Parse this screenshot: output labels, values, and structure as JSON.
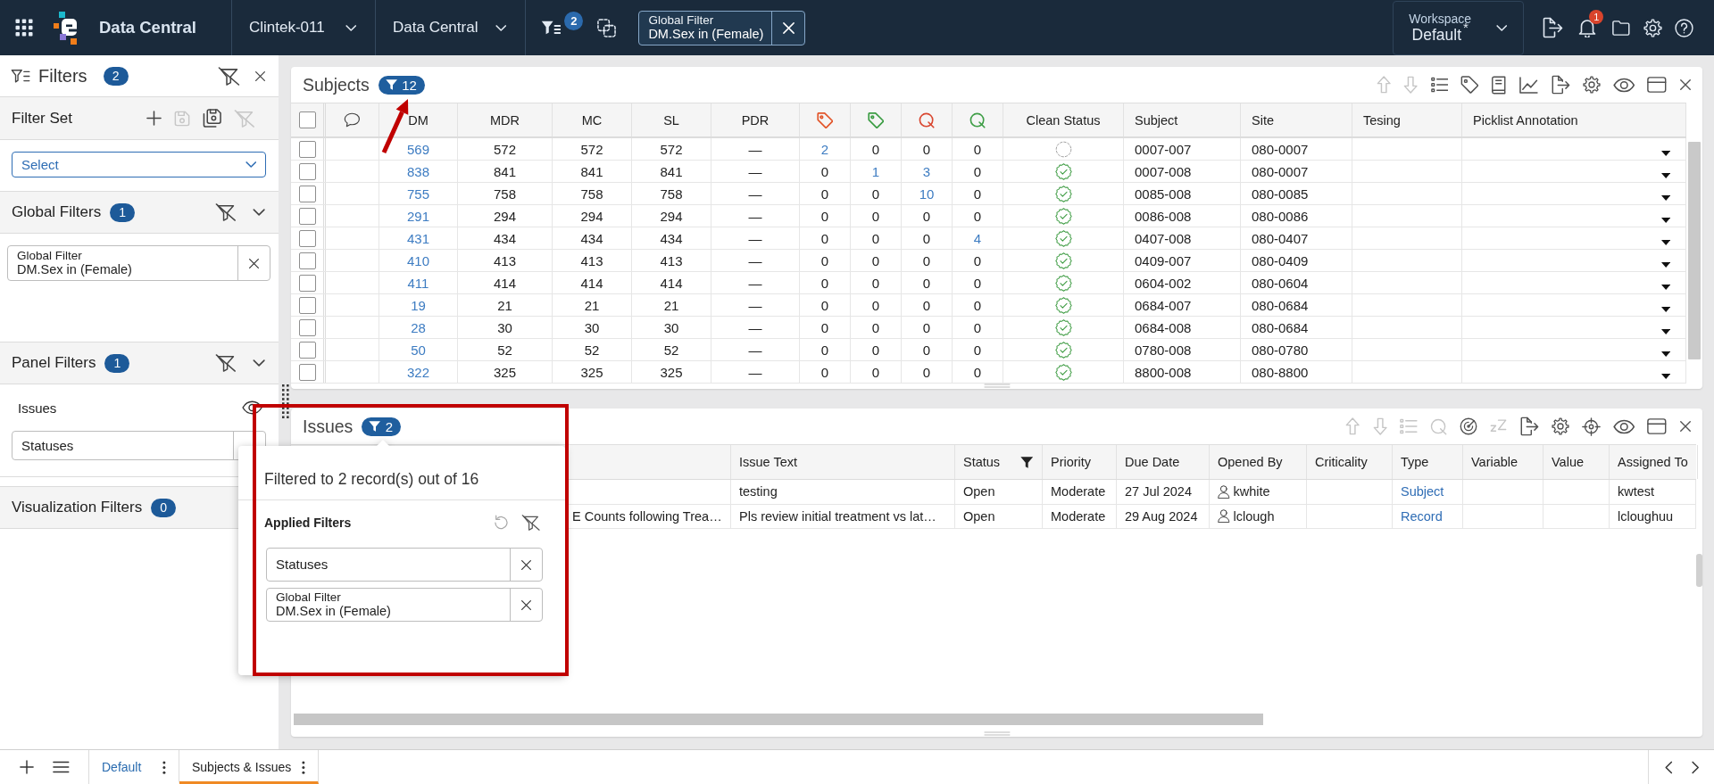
{
  "top_bar": {
    "app_title": "Data Central",
    "study": "Clintek-011",
    "module": "Data Central",
    "filter_count": "2",
    "global_filter": {
      "title": "Global Filter",
      "value": "DM.Sex in (Female)"
    },
    "workspace": {
      "label": "Workspace",
      "modified_mark": "*",
      "name": "Default"
    },
    "notification_count": "1"
  },
  "filters_panel": {
    "title": "Filters",
    "count": "2",
    "filter_set": {
      "title": "Filter Set",
      "actions": [
        {
          "kind": "add",
          "disabled": false
        },
        {
          "kind": "save",
          "disabled": true
        },
        {
          "kind": "save-copy",
          "disabled": false
        },
        {
          "kind": "clear",
          "disabled": true
        }
      ],
      "select": {
        "placeholder": "Select"
      }
    },
    "sections": [
      {
        "kind": "global",
        "title": "Global Filters",
        "count": "1",
        "expanded": true,
        "chips": [
          {
            "title": "Global Filter",
            "value": "DM.Sex in (Female)"
          }
        ]
      },
      {
        "kind": "panel",
        "title": "Panel Filters",
        "count": "1",
        "expanded": true,
        "groups": [
          {
            "name": "Issues",
            "field": {
              "placeholder": "Statuses"
            }
          }
        ]
      },
      {
        "kind": "visualization",
        "title": "Visualization Filters",
        "count": "0"
      }
    ]
  },
  "subjects_panel": {
    "title": "Subjects",
    "filter_count": "12",
    "toolbar": [
      {
        "kind": "move-up",
        "disabled": true
      },
      {
        "kind": "move-down",
        "disabled": true
      },
      {
        "kind": "list",
        "disabled": false
      },
      {
        "kind": "tag",
        "disabled": false
      },
      {
        "kind": "book",
        "disabled": false
      },
      {
        "kind": "chart",
        "disabled": false
      },
      {
        "kind": "export",
        "disabled": false
      },
      {
        "kind": "settings",
        "disabled": false
      },
      {
        "kind": "view",
        "disabled": false
      },
      {
        "kind": "layout",
        "disabled": false
      },
      {
        "kind": "close",
        "disabled": false
      }
    ],
    "table": {
      "select_all_checked": false,
      "columns": [
        {
          "kind": "comments"
        },
        {
          "kind": "number",
          "label": "DM"
        },
        {
          "kind": "number",
          "label": "MDR"
        },
        {
          "kind": "number",
          "label": "MC"
        },
        {
          "kind": "number",
          "label": "SL"
        },
        {
          "kind": "number",
          "label": "PDR"
        },
        {
          "kind": "tag",
          "color": "#e2572c"
        },
        {
          "kind": "tag",
          "color": "#3d9d45"
        },
        {
          "kind": "query",
          "color": "#d9462f"
        },
        {
          "kind": "query",
          "color": "#3d9d45"
        },
        {
          "kind": "status",
          "label": "Clean Status"
        },
        {
          "kind": "text",
          "label": "Subject"
        },
        {
          "kind": "text",
          "label": "Site"
        },
        {
          "kind": "text",
          "label": "Tesing"
        },
        {
          "kind": "text",
          "label": "Picklist Annotation"
        }
      ],
      "rows": [
        {
          "checked": false,
          "dm": "569",
          "mdr": "572",
          "mc": "572",
          "sl": "572",
          "pdr": "—",
          "counts": [
            {
              "value": "2",
              "link": true
            },
            {
              "value": "0",
              "link": false
            },
            {
              "value": "0",
              "link": false
            },
            {
              "value": "0",
              "link": false
            }
          ],
          "clean": false,
          "subject": "0007-007",
          "site": "080-0007"
        },
        {
          "checked": false,
          "dm": "838",
          "mdr": "841",
          "mc": "841",
          "sl": "841",
          "pdr": "—",
          "counts": [
            {
              "value": "0",
              "link": false
            },
            {
              "value": "1",
              "link": true
            },
            {
              "value": "3",
              "link": true
            },
            {
              "value": "0",
              "link": false
            }
          ],
          "clean": true,
          "subject": "0007-008",
          "site": "080-0007"
        },
        {
          "checked": false,
          "dm": "755",
          "mdr": "758",
          "mc": "758",
          "sl": "758",
          "pdr": "—",
          "counts": [
            {
              "value": "0",
              "link": false
            },
            {
              "value": "0",
              "link": false
            },
            {
              "value": "10",
              "link": true
            },
            {
              "value": "0",
              "link": false
            }
          ],
          "clean": true,
          "subject": "0085-008",
          "site": "080-0085"
        },
        {
          "checked": false,
          "dm": "291",
          "mdr": "294",
          "mc": "294",
          "sl": "294",
          "pdr": "—",
          "counts": [
            {
              "value": "0",
              "link": false
            },
            {
              "value": "0",
              "link": false
            },
            {
              "value": "0",
              "link": false
            },
            {
              "value": "0",
              "link": false
            }
          ],
          "clean": true,
          "subject": "0086-008",
          "site": "080-0086"
        },
        {
          "checked": false,
          "dm": "431",
          "mdr": "434",
          "mc": "434",
          "sl": "434",
          "pdr": "—",
          "counts": [
            {
              "value": "0",
              "link": false
            },
            {
              "value": "0",
              "link": false
            },
            {
              "value": "0",
              "link": false
            },
            {
              "value": "4",
              "link": true
            }
          ],
          "clean": true,
          "subject": "0407-008",
          "site": "080-0407"
        },
        {
          "checked": false,
          "dm": "410",
          "mdr": "413",
          "mc": "413",
          "sl": "413",
          "pdr": "—",
          "counts": [
            {
              "value": "0",
              "link": false
            },
            {
              "value": "0",
              "link": false
            },
            {
              "value": "0",
              "link": false
            },
            {
              "value": "0",
              "link": false
            }
          ],
          "clean": true,
          "subject": "0409-007",
          "site": "080-0409"
        },
        {
          "checked": false,
          "dm": "411",
          "mdr": "414",
          "mc": "414",
          "sl": "414",
          "pdr": "—",
          "counts": [
            {
              "value": "0",
              "link": false
            },
            {
              "value": "0",
              "link": false
            },
            {
              "value": "0",
              "link": false
            },
            {
              "value": "0",
              "link": false
            }
          ],
          "clean": true,
          "subject": "0604-002",
          "site": "080-0604"
        },
        {
          "checked": false,
          "dm": "19",
          "mdr": "21",
          "mc": "21",
          "sl": "21",
          "pdr": "—",
          "counts": [
            {
              "value": "0",
              "link": false
            },
            {
              "value": "0",
              "link": false
            },
            {
              "value": "0",
              "link": false
            },
            {
              "value": "0",
              "link": false
            }
          ],
          "clean": true,
          "subject": "0684-007",
          "site": "080-0684"
        },
        {
          "checked": false,
          "dm": "28",
          "mdr": "30",
          "mc": "30",
          "sl": "30",
          "pdr": "—",
          "counts": [
            {
              "value": "0",
              "link": false
            },
            {
              "value": "0",
              "link": false
            },
            {
              "value": "0",
              "link": false
            },
            {
              "value": "0",
              "link": false
            }
          ],
          "clean": true,
          "subject": "0684-008",
          "site": "080-0684"
        },
        {
          "checked": false,
          "dm": "50",
          "mdr": "52",
          "mc": "52",
          "sl": "52",
          "pdr": "—",
          "counts": [
            {
              "value": "0",
              "link": false
            },
            {
              "value": "0",
              "link": false
            },
            {
              "value": "0",
              "link": false
            },
            {
              "value": "0",
              "link": false
            }
          ],
          "clean": true,
          "subject": "0780-008",
          "site": "080-0780"
        },
        {
          "checked": false,
          "dm": "322",
          "mdr": "325",
          "mc": "325",
          "sl": "325",
          "pdr": "—",
          "counts": [
            {
              "value": "0",
              "link": false
            },
            {
              "value": "0",
              "link": false
            },
            {
              "value": "0",
              "link": false
            },
            {
              "value": "0",
              "link": false
            }
          ],
          "clean": true,
          "subject": "8800-008",
          "site": "080-8800"
        }
      ]
    }
  },
  "issues_panel": {
    "title": "Issues",
    "filter_count": "2",
    "toolbar": [
      {
        "kind": "move-up",
        "disabled": true
      },
      {
        "kind": "move-down",
        "disabled": true
      },
      {
        "kind": "list",
        "disabled": true
      },
      {
        "kind": "query",
        "disabled": true
      },
      {
        "kind": "radar",
        "disabled": false
      },
      {
        "kind": "snooze",
        "disabled": true
      },
      {
        "kind": "export",
        "disabled": false
      },
      {
        "kind": "settings",
        "disabled": false
      },
      {
        "kind": "target",
        "disabled": false
      },
      {
        "kind": "view",
        "disabled": false
      },
      {
        "kind": "layout",
        "disabled": false
      },
      {
        "kind": "close",
        "disabled": false
      }
    ],
    "table": {
      "columns": [
        {
          "label": "Issue Text",
          "filtered": false
        },
        {
          "label": "Status",
          "filtered": true
        },
        {
          "label": "Priority",
          "filtered": false
        },
        {
          "label": "Due Date",
          "filtered": false
        },
        {
          "label": "Opened By",
          "filtered": false
        },
        {
          "label": "Criticality",
          "filtered": false
        },
        {
          "label": "Type",
          "filtered": false
        },
        {
          "label": "Variable",
          "filtered": false
        },
        {
          "label": "Value",
          "filtered": false
        },
        {
          "label": "Assigned To",
          "filtered": false
        }
      ],
      "rows": [
        {
          "issue_text": "testing",
          "status": "Open",
          "priority": "Moderate",
          "due_date": "27 Jul 2024",
          "opened_by": "kwhite",
          "type": "Subject",
          "assigned_to": "kwtest"
        },
        {
          "column_1": "E Counts following Trea…",
          "issue_text": "Pls review initial treatment vs lat…",
          "status": "Open",
          "priority": "Moderate",
          "due_date": "29 Aug 2024",
          "opened_by": "lclough",
          "type": "Record",
          "assigned_to": "lcloughuu"
        }
      ]
    }
  },
  "filter_popup": {
    "summary": "Filtered to 2 record(s) out of 16",
    "title": "Applied Filters",
    "filters": [
      {
        "value": "Statuses"
      },
      {
        "title": "Global Filter",
        "value": "DM.Sex in (Female)"
      }
    ]
  },
  "bottom_bar": {
    "tabs": [
      {
        "label": "Default",
        "selected": false
      },
      {
        "label": "Subjects & Issues",
        "selected": true
      }
    ]
  }
}
